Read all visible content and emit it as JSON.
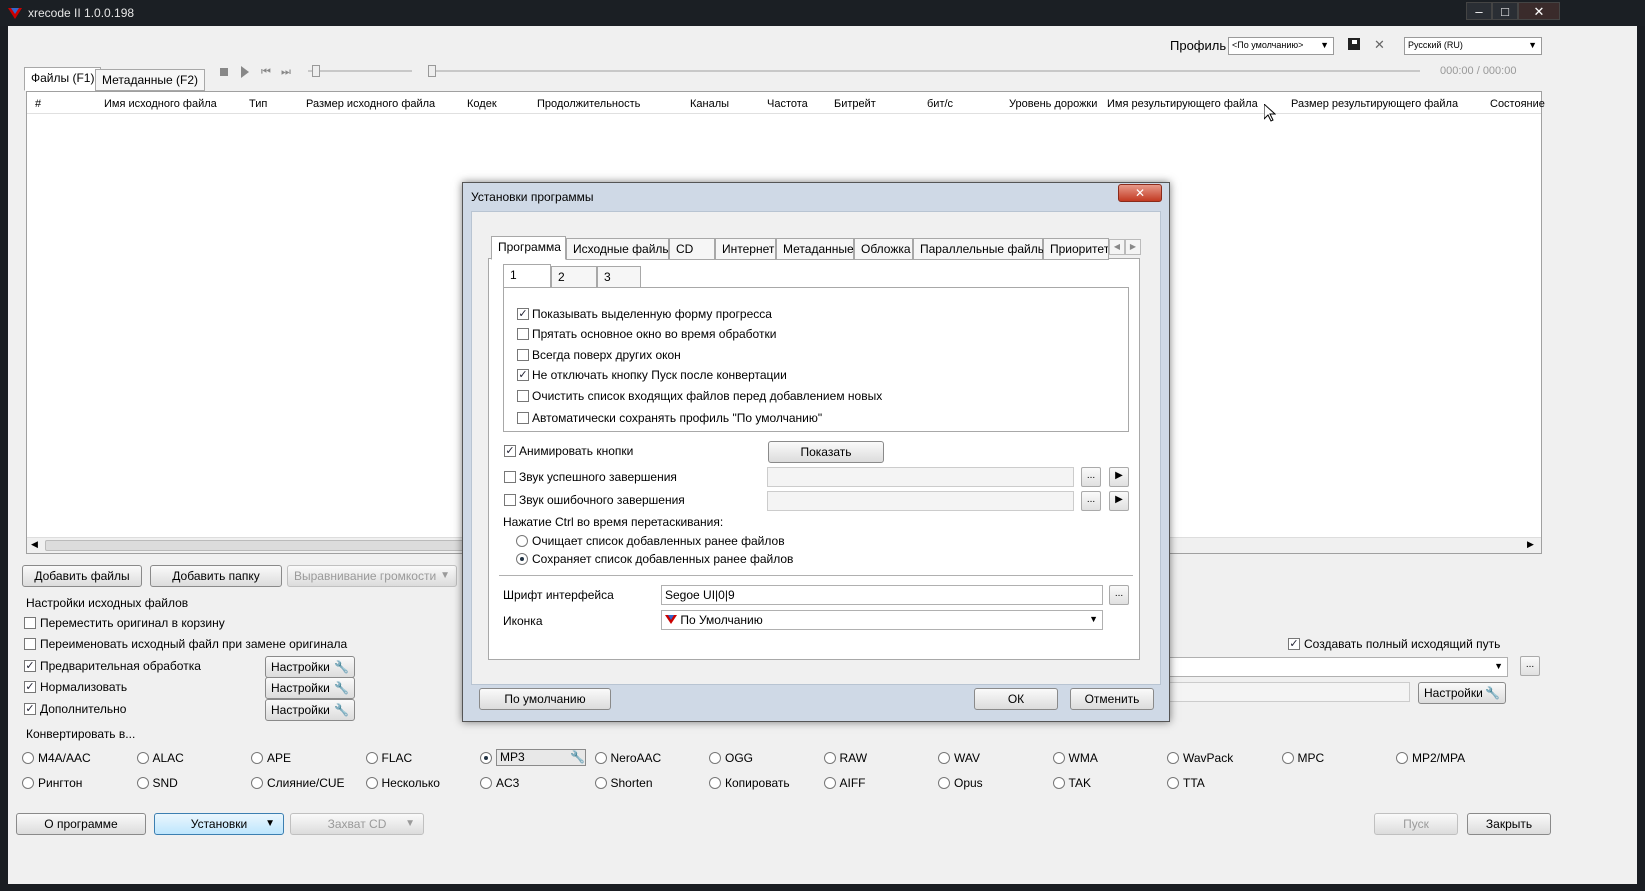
{
  "window": {
    "title": "xrecode II 1.0.0.198"
  },
  "profile": {
    "label": "Профиль",
    "value": "<По умолчанию>",
    "language": "Русский (RU)"
  },
  "tabs": {
    "files": "Файлы (F1)",
    "metadata": "Метаданные (F2)"
  },
  "player": {
    "time": "000:00 / 000:00"
  },
  "columns": [
    "#",
    "Имя исходного файла",
    "Тип",
    "Размер исходного файла",
    "Кодек",
    "Продолжительность",
    "Каналы",
    "Частота",
    "Битрейт",
    "бит/с",
    "Уровень дорожки",
    "Имя результирующего файла",
    "Размер результирующего файла",
    "Состояние"
  ],
  "buttons": {
    "add_files": "Добавить файлы",
    "add_folder": "Добавить папку",
    "volume": "Выравнивание громкости",
    "about": "О программе",
    "settings": "Установки",
    "cd": "Захват CD",
    "start": "Пуск",
    "close": "Закрыть",
    "settings_right": "Настройки"
  },
  "source_settings": {
    "title": "Настройки исходных файлов",
    "items": [
      {
        "label": "Переместить оригинал в корзину",
        "checked": false
      },
      {
        "label": "Переименовать исходный файл при замене оригинала",
        "checked": false
      },
      {
        "label": "Предварительная обработка",
        "checked": true,
        "button": "Настройки"
      },
      {
        "label": "Нормализовать",
        "checked": true,
        "button": "Настройки"
      },
      {
        "label": "Дополнительно",
        "checked": true,
        "button": "Настройки"
      }
    ],
    "full_path": "Создавать полный исходящий путь"
  },
  "convert": {
    "title": "Конвертировать в...",
    "row1": [
      "M4A/AAC",
      "ALAC",
      "APE",
      "FLAC",
      "MP3",
      "NeroAAC",
      "OGG",
      "RAW",
      "WAV",
      "WMA",
      "WavPack",
      "MPC",
      "MP2/MPA"
    ],
    "row2": [
      "Рингтон",
      "SND",
      "Слияние/CUE",
      "Несколько",
      "AC3",
      "Shorten",
      "Копировать",
      "AIFF",
      "Opus",
      "TAK",
      "TTA"
    ],
    "selected": "MP3"
  },
  "dialog": {
    "title": "Установки программы",
    "tabs": [
      "Программа",
      "Исходные файлы",
      "CD",
      "Интернет",
      "Метаданные",
      "Обложка",
      "Параллельные файлы",
      "Приоритет"
    ],
    "subtabs": [
      "1",
      "2",
      "3"
    ],
    "options": [
      {
        "label": "Показывать выделенную форму прогресса",
        "checked": true
      },
      {
        "label": "Прятать основное окно во время обработки",
        "checked": false
      },
      {
        "label": "Всегда поверх других окон",
        "checked": false
      },
      {
        "label": "Не отключать кнопку Пуск после конвертации",
        "checked": true
      },
      {
        "label": "Очистить список входящих файлов перед добавлением новых",
        "checked": false
      },
      {
        "label": "Автоматически сохранять профиль \"По умолчанию\"",
        "checked": false
      }
    ],
    "animate": {
      "label": "Анимировать кнопки",
      "checked": true,
      "button": "Показать"
    },
    "sound_ok": "Звук успешного завершения",
    "sound_err": "Звук ошибочного завершения",
    "ctrl_title": "Нажатие Ctrl во время перетаскивания:",
    "ctrl_opts": [
      "Очищает список добавленных ранее файлов",
      "Сохраняет список добавленных ранее файлов"
    ],
    "font_label": "Шрифт интерфейса",
    "font_value": "Segoe UI|0|9",
    "icon_label": "Иконка",
    "icon_value": "По Умолчанию",
    "default_btn": "По умолчанию",
    "ok": "ОК",
    "cancel": "Отменить",
    "dots": "..."
  }
}
